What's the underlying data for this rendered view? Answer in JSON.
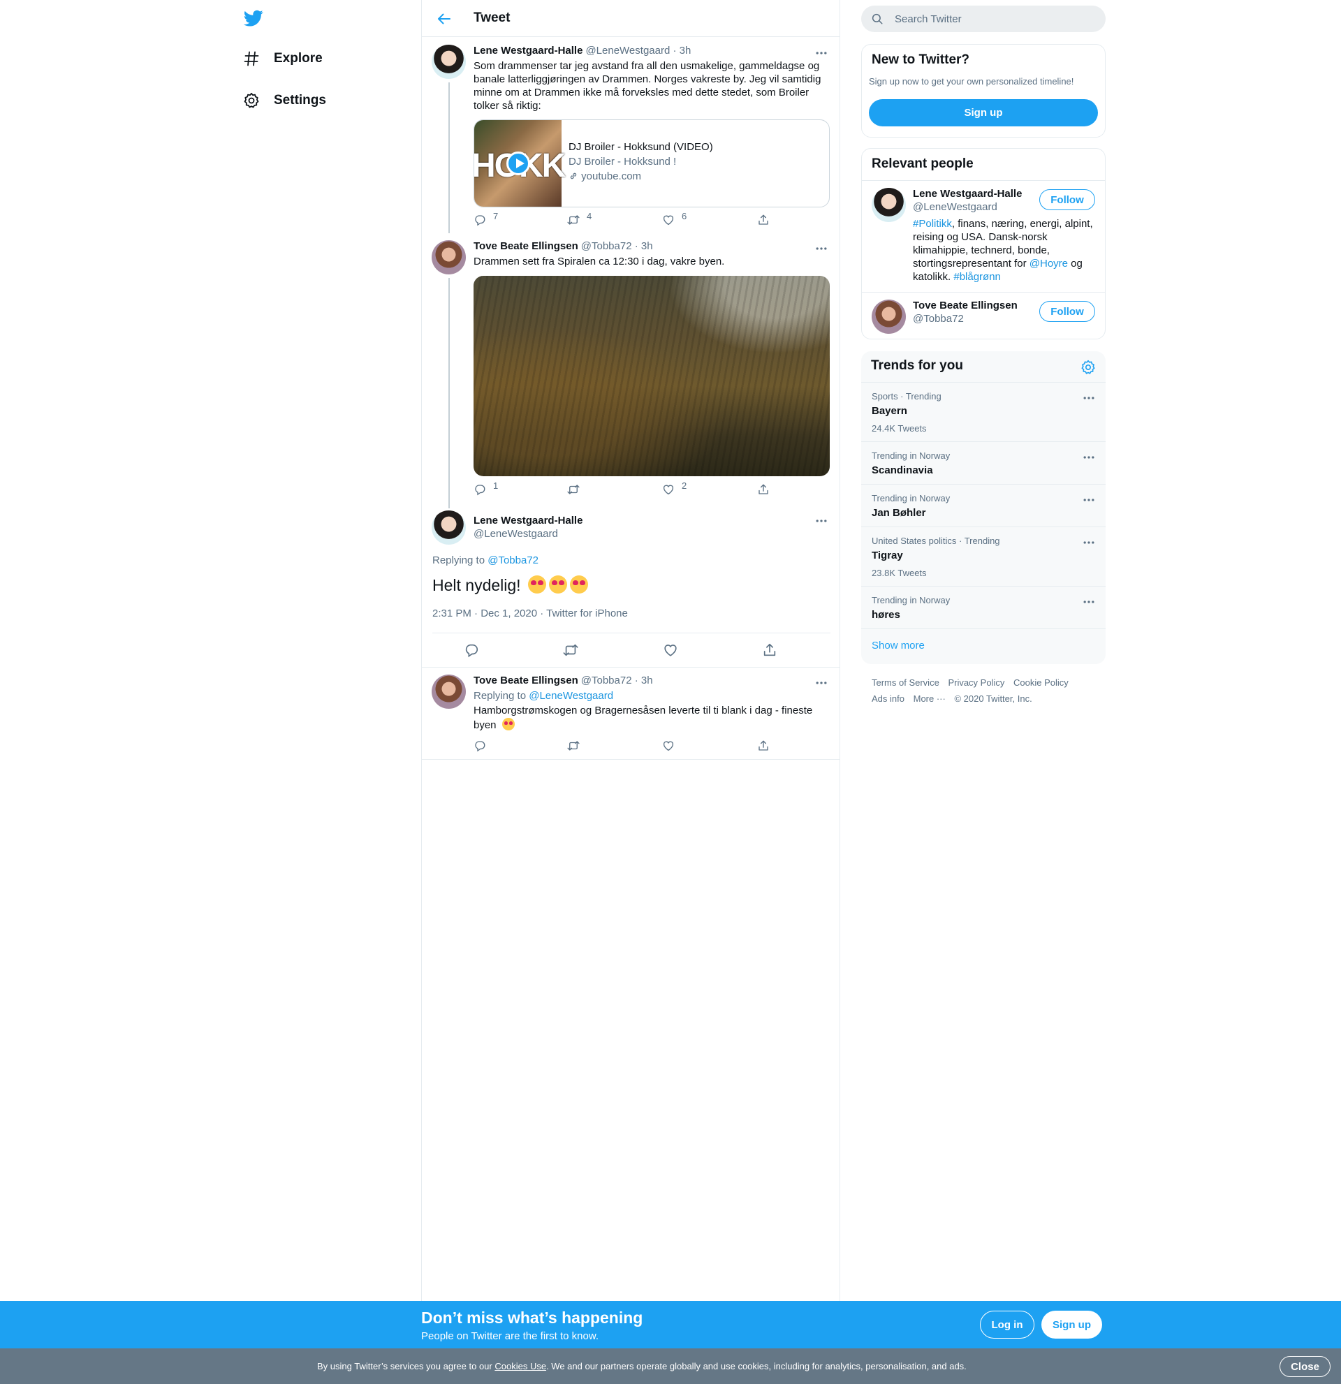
{
  "colors": {
    "brand": "#1da1f2",
    "link": "#1b95e0",
    "muted": "#5b7083",
    "border": "#e6ecf0",
    "cookie_bar": "#657786"
  },
  "nav": {
    "logo_icon": "twitter-bird-icon",
    "items": [
      {
        "label": "Explore",
        "icon": "hashtag-icon"
      },
      {
        "label": "Settings",
        "icon": "gear-icon"
      }
    ]
  },
  "header": {
    "title": "Tweet",
    "back_icon": "back-arrow-icon"
  },
  "tweets": [
    {
      "name": "Lene Westgaard-Halle",
      "handle": "@LeneWestgaard",
      "time": "· 3h",
      "text": "Som drammenser tar jeg avstand fra all den usmakelige, gammeldagse og banale latterliggjøringen av Drammen. Norges vakreste by. Jeg vil samtidig minne om at Drammen ikke må forveksles med dette stedet, som Broiler tolker så riktig:",
      "card": {
        "thumb_text": "HOKK",
        "title": "DJ Broiler - Hokksund (VIDEO)",
        "description": "DJ Broiler - Hokksund !",
        "domain": "youtube.com"
      },
      "replies": "7",
      "retweets": "4",
      "likes": "6"
    },
    {
      "name": "Tove Beate Ellingsen",
      "handle": "@Tobba72",
      "time": "· 3h",
      "text": "Drammen sett fra Spiralen ca 12:30 i dag, vakre byen.",
      "replies": "1",
      "retweets": "",
      "likes": "2"
    }
  ],
  "main_tweet": {
    "name": "Lene Westgaard-Halle",
    "handle": "@LeneWestgaard",
    "replying_label": "Replying to",
    "replying_to": "@Tobba72",
    "text": "Helt nydelig!",
    "meta": "2:31 PM · Dec 1, 2020 · Twitter for iPhone"
  },
  "reply_tweet": {
    "name": "Tove Beate Ellingsen",
    "handle": "@Tobba72",
    "time": "· 3h",
    "replying_label": "Replying to",
    "replying_to": "@LeneWestgaard",
    "text": "Hamborgstrømskogen og Bragernesåsen leverte til ti blank i dag - fineste byen"
  },
  "search": {
    "placeholder": "Search Twitter"
  },
  "new_to_twitter": {
    "title": "New to Twitter?",
    "subtitle": "Sign up now to get your own personalized timeline!",
    "button": "Sign up"
  },
  "relevant_people": {
    "title": "Relevant people",
    "follow_label": "Follow",
    "people": [
      {
        "name": "Lene Westgaard-Halle",
        "handle": "@LeneWestgaard",
        "bio_tag1": "#Politikk",
        "bio_part1": ", finans, næring, energi, alpint, reising og USA. Dansk-norsk klimahippie, technerd, bonde, stortingsrepresentant for ",
        "bio_tag2": "@Hoyre",
        "bio_part2": " og katolikk. ",
        "bio_tag3": "#blågrønn"
      },
      {
        "name": "Tove Beate Ellingsen",
        "handle": "@Tobba72"
      }
    ]
  },
  "trends": {
    "title": "Trends for you",
    "items": [
      {
        "context": "Sports · Trending",
        "name": "Bayern",
        "count": "24.4K Tweets"
      },
      {
        "context": "Trending in Norway",
        "name": "Scandinavia",
        "count": ""
      },
      {
        "context": "Trending in Norway",
        "name": "Jan Bøhler",
        "count": ""
      },
      {
        "context": "United States politics · Trending",
        "name": "Tigray",
        "count": "23.8K Tweets"
      },
      {
        "context": "Trending in Norway",
        "name": "høres",
        "count": ""
      }
    ],
    "show_more": "Show more"
  },
  "footer": {
    "links": [
      "Terms of Service",
      "Privacy Policy",
      "Cookie Policy",
      "Ads info",
      "More ···"
    ],
    "copyright": "© 2020 Twitter, Inc."
  },
  "bottom_bar": {
    "title": "Don’t miss what’s happening",
    "subtitle": "People on Twitter are the first to know.",
    "login": "Log in",
    "signup": "Sign up"
  },
  "cookie_bar": {
    "text_before": "By using Twitter’s services you agree to our ",
    "link": "Cookies Use",
    "text_after": ". We and our partners operate globally and use cookies, including for analytics, personalisation, and ads.",
    "close": "Close"
  }
}
